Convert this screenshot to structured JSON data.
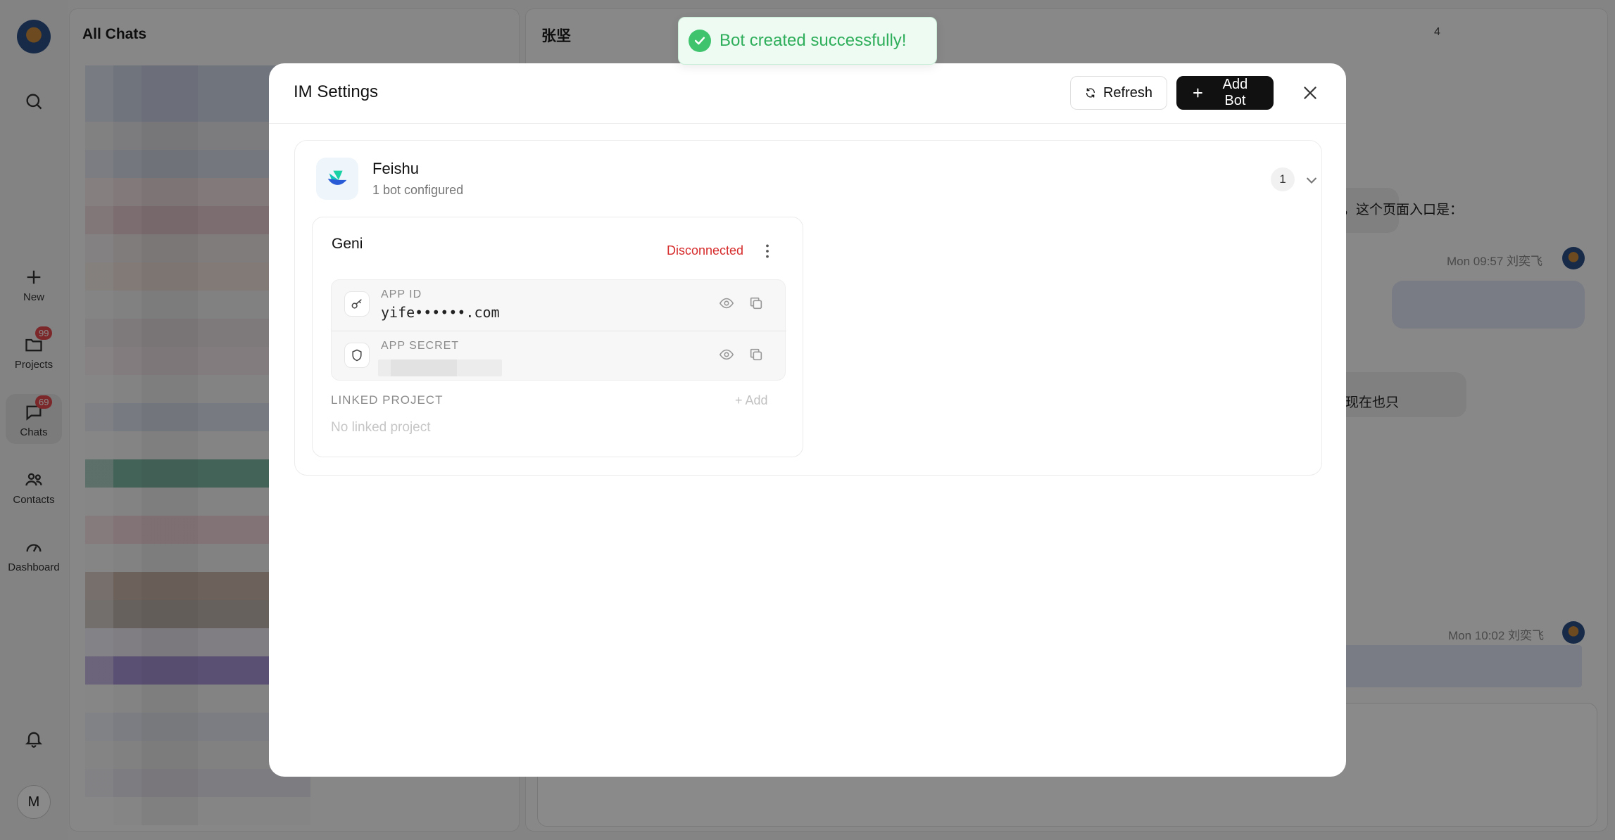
{
  "background": {
    "rail": {
      "items": [
        {
          "label": "New"
        },
        {
          "label": "Projects",
          "badge": "99"
        },
        {
          "label": "Chats",
          "badge": "69"
        },
        {
          "label": "Contacts"
        },
        {
          "label": "Dashboard"
        }
      ],
      "user_initial": "M"
    },
    "chat_list": {
      "title": "All Chats"
    },
    "chat": {
      "title": "张坚",
      "member_count": "4",
      "message_snippet_1": "，这个页面入口是：",
      "meta_1": "Mon 09:57  刘奕飞",
      "message_snippet_2": "现在也只",
      "meta_2": "Mon 10:02  刘奕飞"
    }
  },
  "modal": {
    "title": "IM Settings",
    "refresh_label": "Refresh",
    "add_bot_label": "Add Bot",
    "provider": {
      "name": "Feishu",
      "subtitle": "1 bot configured",
      "count": "1",
      "bot": {
        "name": "Geni",
        "status": "Disconnected",
        "app_id_label": "APP ID",
        "app_id_value": "yife••••••.com",
        "app_secret_label": "APP SECRET",
        "linked_project_label": "LINKED PROJECT",
        "add_label": "+ Add",
        "no_linked_project": "No linked project"
      }
    }
  },
  "toast": {
    "message": "Bot created successfully!"
  },
  "colors": {
    "status_disconnected": "#d62b2b",
    "toast_success": "#2eae5a",
    "primary_button": "#111111"
  },
  "icons": [
    "search-icon",
    "plus-icon",
    "folder-icon",
    "chat-icon",
    "contacts-icon",
    "dashboard-icon",
    "bell-icon",
    "refresh-icon",
    "close-icon",
    "chevron-down-icon",
    "more-vertical-icon",
    "key-icon",
    "shield-icon",
    "eye-icon",
    "copy-icon",
    "check-circle-icon",
    "feishu-logo-icon"
  ]
}
